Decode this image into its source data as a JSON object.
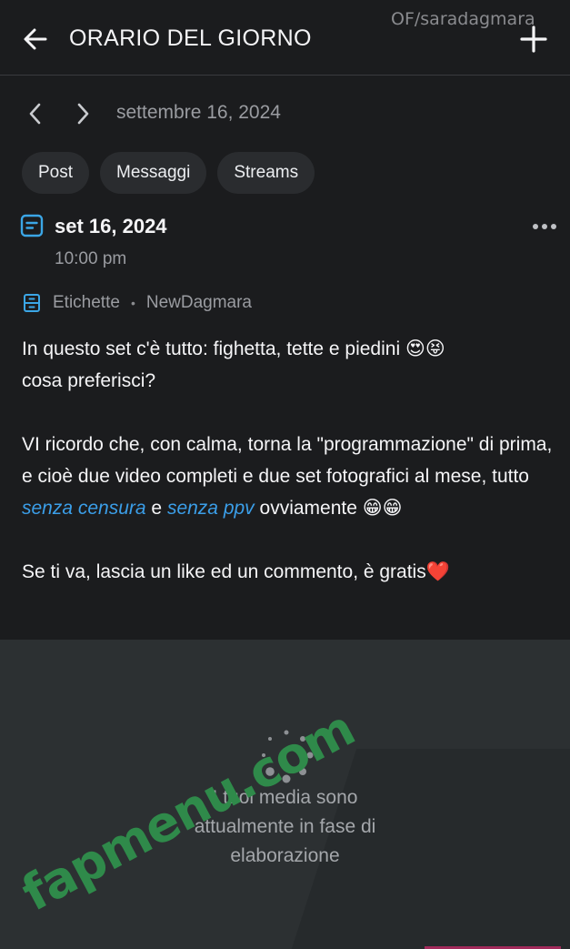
{
  "header": {
    "title": "ORARIO DEL GIORNO",
    "watermark": "OF/saradagmara",
    "back_icon": "arrow-left-icon",
    "add_icon": "plus-icon"
  },
  "date_nav": {
    "date": "settembre 16, 2024",
    "prev_icon": "chevron-left-icon",
    "next_icon": "chevron-right-icon"
  },
  "tabs": [
    {
      "label": "Post"
    },
    {
      "label": "Messaggi"
    },
    {
      "label": "Streams"
    }
  ],
  "post": {
    "date": "set 16, 2024",
    "time": "10:00 pm",
    "labels_text": "Etichette",
    "label_value": "NewDagmara",
    "separator": "•",
    "body": {
      "p1": "In questo set c'è tutto: fighetta, tette e piedini 😍😝",
      "p2": "cosa preferisci?",
      "p3_a": "VI ricordo che, con calma, torna la \"programmazione\" di prima, e cioè due video completi e due set fotografici al mese, tutto ",
      "p3_hl1": "senza censura",
      "p3_b": " e ",
      "p3_hl2": "senza ppv",
      "p3_c": " ovviamente 😁😁",
      "p4": "Se ti va, lascia un like ed un commento, è gratis❤️"
    }
  },
  "media": {
    "message_line1": "I tuoi media sono",
    "message_line2": "attualmente in fase di",
    "message_line3": "elaborazione",
    "watermark": "fapmenu.com"
  },
  "colors": {
    "background": "#1b1c1e",
    "accent_link": "#3b9ee8",
    "icon_blue": "#3ba6e6",
    "watermark_green": "#2f8a4a"
  }
}
